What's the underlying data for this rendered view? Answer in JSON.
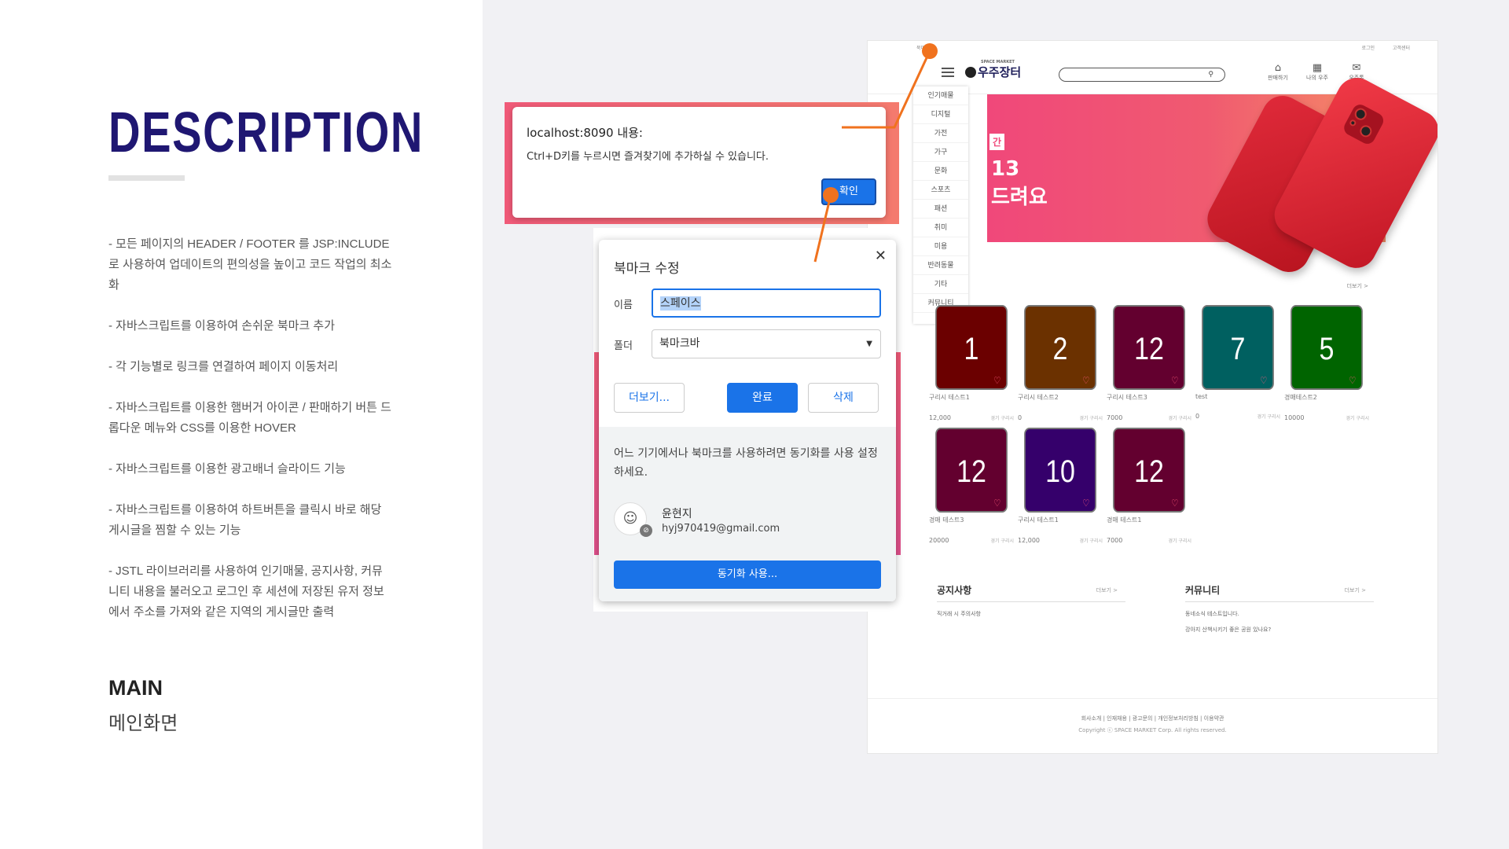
{
  "left": {
    "title": "DESCRIPTION",
    "bullets": [
      "- 모든 페이지의 HEADER / FOOTER 를 JSP:INCLUDE 로 사용하여 업데이트의 편의성을 높이고 코드 작업의 최소화",
      "- 자바스크립트를 이용하여 손쉬운 북마크 추가",
      "- 각 기능별로 링크를 연결하여 페이지 이동처리",
      "- 자바스크립트를 이용한 햄버거 아이콘 / 판매하기 버튼 드롭다운 메뉴와 CSS를 이용한 HOVER",
      "- 자바스크립트를 이용한 광고배너 슬라이드 기능",
      "- 자바스크립트를 이용하여 하트버튼을 클릭시 바로 해당 게시글을 찜할 수 있는 기능",
      "- JSTL 라이브러리를 사용하여 인기매물, 공지사항, 커뮤니티 내용을 불러오고 로그인 후 세션에 저장된 유저 정보에서 주소를 가져와 같은 지역의 게시글만 출력"
    ],
    "section_label": "MAIN",
    "section_sub": "메인화면"
  },
  "site": {
    "topbar": {
      "bookmark": "북마크",
      "login": "로그인",
      "support": "고객센터"
    },
    "logo_small": "SPACE MARKET",
    "logo": "우주장터",
    "header_icons": [
      {
        "icon": "sell-icon",
        "glyph": "⌂",
        "label": "판매하기"
      },
      {
        "icon": "store-icon",
        "glyph": "▦",
        "label": "나의 우주"
      },
      {
        "icon": "chat-icon",
        "glyph": "✉",
        "label": "우주톡"
      }
    ],
    "banner": {
      "tag": "간",
      "line1": "13",
      "line2": "드려요"
    },
    "menu": [
      "인기매물",
      "디지털",
      "가전",
      "가구",
      "문화",
      "스포츠",
      "패션",
      "취미",
      "미용",
      "반려동물",
      "기타",
      "커뮤니티"
    ],
    "more": "더보기 >",
    "cards": [
      {
        "num": "1",
        "color": "#6b0000",
        "name": "구리시 테스트1",
        "price": "12,000",
        "area": "경기 구리시"
      },
      {
        "num": "2",
        "color": "#6b3100",
        "name": "구리시 테스트2",
        "price": "0",
        "area": "경기 구리시"
      },
      {
        "num": "12",
        "color": "#63002f",
        "name": "구리시 테스트3",
        "price": "7000",
        "area": "경기 구리시"
      },
      {
        "num": "7",
        "color": "#006060",
        "name": "test",
        "price": "0",
        "area": "경기 구리시"
      },
      {
        "num": "5",
        "color": "#006400",
        "name": "경매테스트2",
        "price": "10000",
        "area": "경기 구리시"
      },
      {
        "num": "12",
        "color": "#63002f",
        "name": "경매 테스트3",
        "price": "20000",
        "area": "경기 구리시"
      },
      {
        "num": "10",
        "color": "#35006b",
        "name": "구리시 테스트1",
        "price": "12,000",
        "area": "경기 구리시"
      },
      {
        "num": "12",
        "color": "#63002f",
        "name": "경매 테스트1",
        "price": "7000",
        "area": "경기 구리시"
      }
    ],
    "notice": {
      "title": "공지사항",
      "more": "더보기 >",
      "items": [
        "직거래 시 주의사항"
      ]
    },
    "community": {
      "title": "커뮤니티",
      "more": "더보기 >",
      "items": [
        "동네소식 테스트입니다.",
        "강아지 산책시키기 좋은 공원 있나요?"
      ]
    },
    "footer": {
      "links": "회사소개 | 인재채용 | 광고문의 | 개인정보처리방침 | 이용약관",
      "copyright": "Copyright ⓒ SPACE MARKET Corp. All rights reserved."
    }
  },
  "alert": {
    "title": "localhost:8090 내용:",
    "message": "Ctrl+D키를 누르시면 즐겨찾기에 추가하실 수 있습니다.",
    "ok": "확인"
  },
  "bookmark": {
    "title": "북마크 수정",
    "close": "✕",
    "name_label": "이름",
    "name_value": "스페이스",
    "folder_label": "폴더",
    "folder_value": "북마크바",
    "more": "더보기...",
    "done": "완료",
    "delete": "삭제",
    "sync_message": "어느 기기에서나 북마크를 사용하려면 동기화를 사용 설정하세요.",
    "user_name": "윤현지",
    "user_email": "hyj970419@gmail.com",
    "sync_button": "동기화 사용..."
  },
  "colors": {
    "title": "#1f1772",
    "accent": "#f0721e",
    "chrome_blue": "#1a73e8"
  }
}
